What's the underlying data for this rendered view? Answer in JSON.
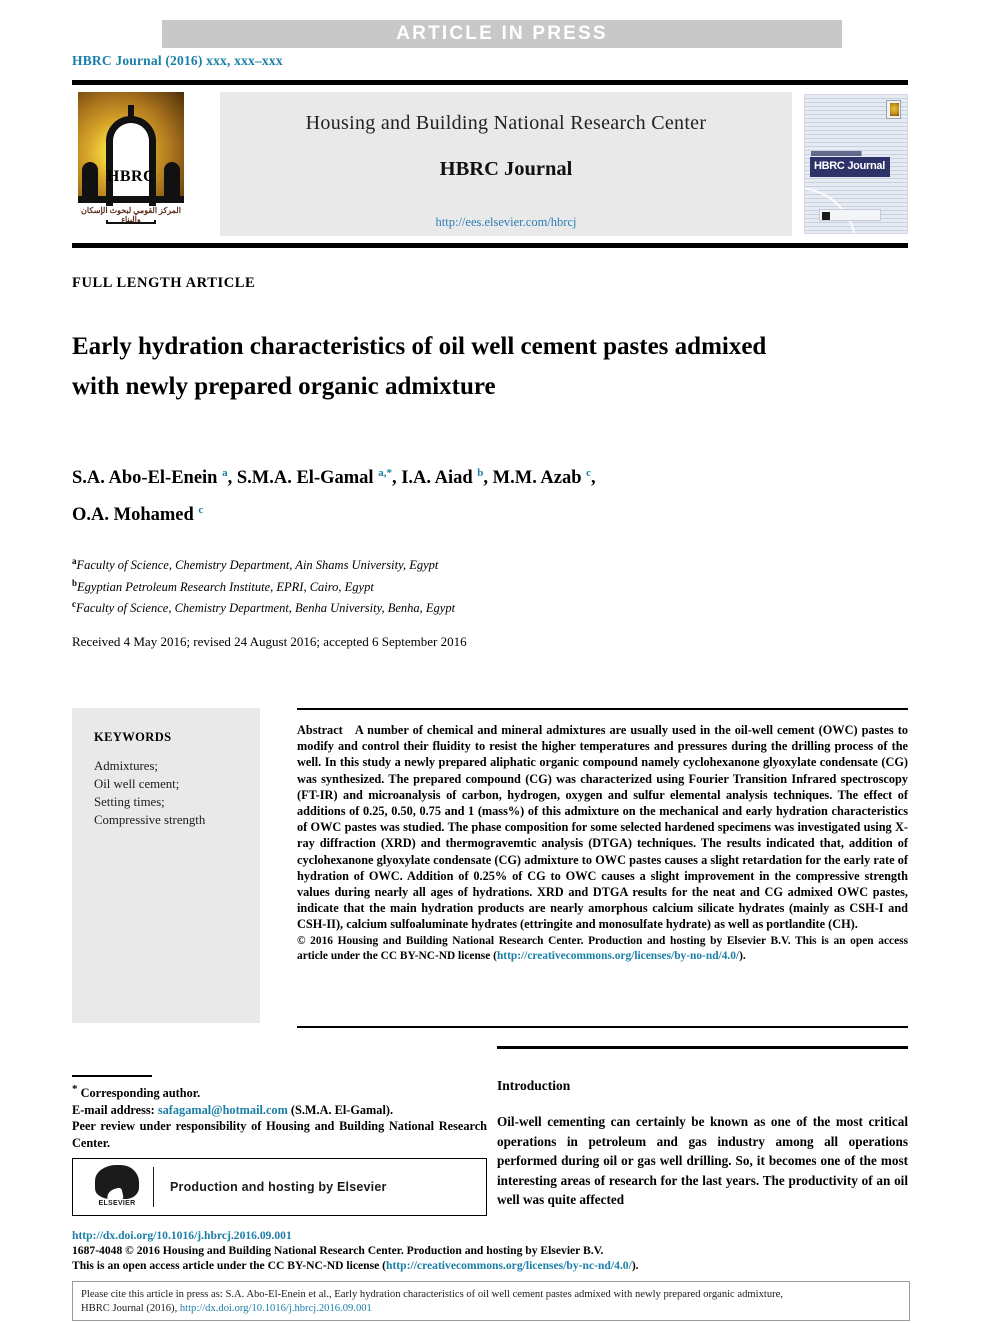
{
  "banner": {
    "press_label": "ARTICLE  IN  PRESS"
  },
  "running_head": "HBRC Journal (2016) xxx, xxx–xxx",
  "journal_header": {
    "publisher_line": "Housing and Building National Research Center",
    "journal_name": "HBRC Journal",
    "submission_url": "http://ees.elsevier.com/hbrcj",
    "logo_text": "HBRC",
    "logo_arabic": "المركز القومي لبحوث الإسكان والبناء",
    "cover_band_text": "HBRC Journal"
  },
  "article": {
    "type_label": "FULL LENGTH ARTICLE",
    "title": "Early hydration characteristics of oil well cement pastes admixed with newly prepared organic admixture",
    "authors_line1_html": "S.A. Abo-El-Enein <sup>a</sup>, S.M.A. El-Gamal <sup>a,*</sup>, I.A. Aiad <sup>b</sup>, M.M. Azab <sup>c</sup>,",
    "authors_line2_html": "O.A. Mohamed <sup>c</sup>",
    "affiliations": [
      {
        "marker": "a",
        "text": "Faculty of Science, Chemistry Department, Ain Shams University, Egypt"
      },
      {
        "marker": "b",
        "text": "Egyptian Petroleum Research Institute, EPRI, Cairo, Egypt"
      },
      {
        "marker": "c",
        "text": "Faculty of Science, Chemistry Department, Benha University, Benha, Egypt"
      }
    ],
    "dates": "Received 4 May 2016; revised 24 August 2016; accepted 6 September 2016"
  },
  "keywords": {
    "heading": "KEYWORDS",
    "items": "Admixtures;\nOil well cement;\nSetting times;\nCompressive strength"
  },
  "abstract": {
    "label": "Abstract",
    "body": "A number of chemical and mineral admixtures are usually used in the oil-well cement (OWC) pastes to modify and control their fluidity to resist the higher temperatures and pressures during the drilling process of the well. In this study a newly prepared aliphatic organic compound namely cyclohexanone glyoxylate condensate (CG) was synthesized. The prepared compound (CG) was characterized using Fourier Transition Infrared spectroscopy (FT-IR) and microanalysis of carbon, hydrogen, oxygen and sulfur elemental analysis techniques. The effect of additions of 0.25, 0.50, 0.75 and 1 (mass%) of this admixture on the mechanical and early hydration characteristics of OWC pastes was studied. The phase composition for some selected hardened specimens was investigated using X-ray diffraction (XRD) and thermogravemtic analysis (DTGA) techniques. The results indicated that, addition of cyclohexanone glyoxylate condensate (CG) admixture to OWC pastes causes a slight retardation for the early rate of hydration of OWC. Addition of 0.25% of CG to OWC causes a slight improvement in the compressive strength values during nearly all ages of hydrations. XRD and DTGA results for the neat and CG admixed OWC pastes, indicate that the main hydration products are nearly amorphous calcium silicate hydrates (mainly as CSH-I and CSH-II), calcium sulfoaluminate hydrates (ettringite and monosulfate hydrate) as well as portlandite (CH).",
    "copyright_pre": "© 2016 Housing and Building National Research Center. Production and hosting by Elsevier B.V. This is an open access article under the CC BY-NC-ND license (",
    "copyright_link": "http://creativecommons.org/licenses/by-no-nd/4.0/",
    "copyright_post": ")."
  },
  "footnote": {
    "corresponding": "Corresponding author.",
    "email_label": "E-mail address:",
    "email": "safagamal@hotmail.com",
    "email_owner": "(S.M.A. El-Gamal).",
    "peer_review": "Peer review under responsibility of Housing and Building National Research Center."
  },
  "elsevier": {
    "logo_word": "ELSEVIER",
    "caption": "Production and hosting by Elsevier"
  },
  "doi_block": {
    "doi_url": "http://dx.doi.org/10.1016/j.hbrcj.2016.09.001",
    "issn_line": "1687-4048 © 2016 Housing and Building National Research Center. Production and hosting by Elsevier B.V.",
    "license_pre": "This is an open access article under the CC BY-NC-ND license (",
    "license_link": "http://creativecommons.org/licenses/by-nc-nd/4.0/",
    "license_post": ")."
  },
  "citation": {
    "line1": "Please cite this article in press as: S.A. Abo-El-Enein et al., Early hydration characteristics of oil well cement pastes admixed with newly prepared organic admixture,",
    "line2_pre": "HBRC Journal (2016), ",
    "line2_link": "http://dx.doi.org/10.1016/j.hbrcj.2016.09.001"
  },
  "introduction": {
    "heading": "Introduction",
    "body": "Oil-well cementing can certainly be known as one of the most critical operations in petroleum and gas industry among all operations performed during oil or gas well drilling. So, it becomes one of the most interesting areas of research for the last years. The productivity of an oil well was quite affected"
  },
  "colors": {
    "link": "#1a7fa8",
    "banner_bg": "#c8c8c8",
    "panel_bg": "#e9e9e9"
  }
}
